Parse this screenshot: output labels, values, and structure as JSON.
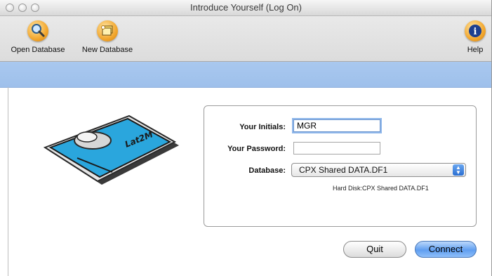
{
  "window": {
    "title": "Introduce Yourself (Log On)"
  },
  "toolbar": {
    "open_database_label": "Open Database",
    "new_database_label": "New Database",
    "help_label": "Help",
    "open_icon": "magnifier-icon",
    "new_icon": "new-database-icon",
    "help_icon": "info-icon"
  },
  "form": {
    "initials_label": "Your Initials:",
    "initials_value": "MGR",
    "password_label": "Your Password:",
    "password_value": "",
    "database_label": "Database:",
    "database_selected": "CPX Shared DATA.DF1",
    "database_path": "Hard Disk:CPX Shared DATA.DF1"
  },
  "buttons": {
    "quit_label": "Quit",
    "connect_label": "Connect"
  },
  "illustration": {
    "text": "Lat2M"
  },
  "colors": {
    "accent_blue": "#9ec0eb",
    "default_button": "#5f9ef0"
  }
}
